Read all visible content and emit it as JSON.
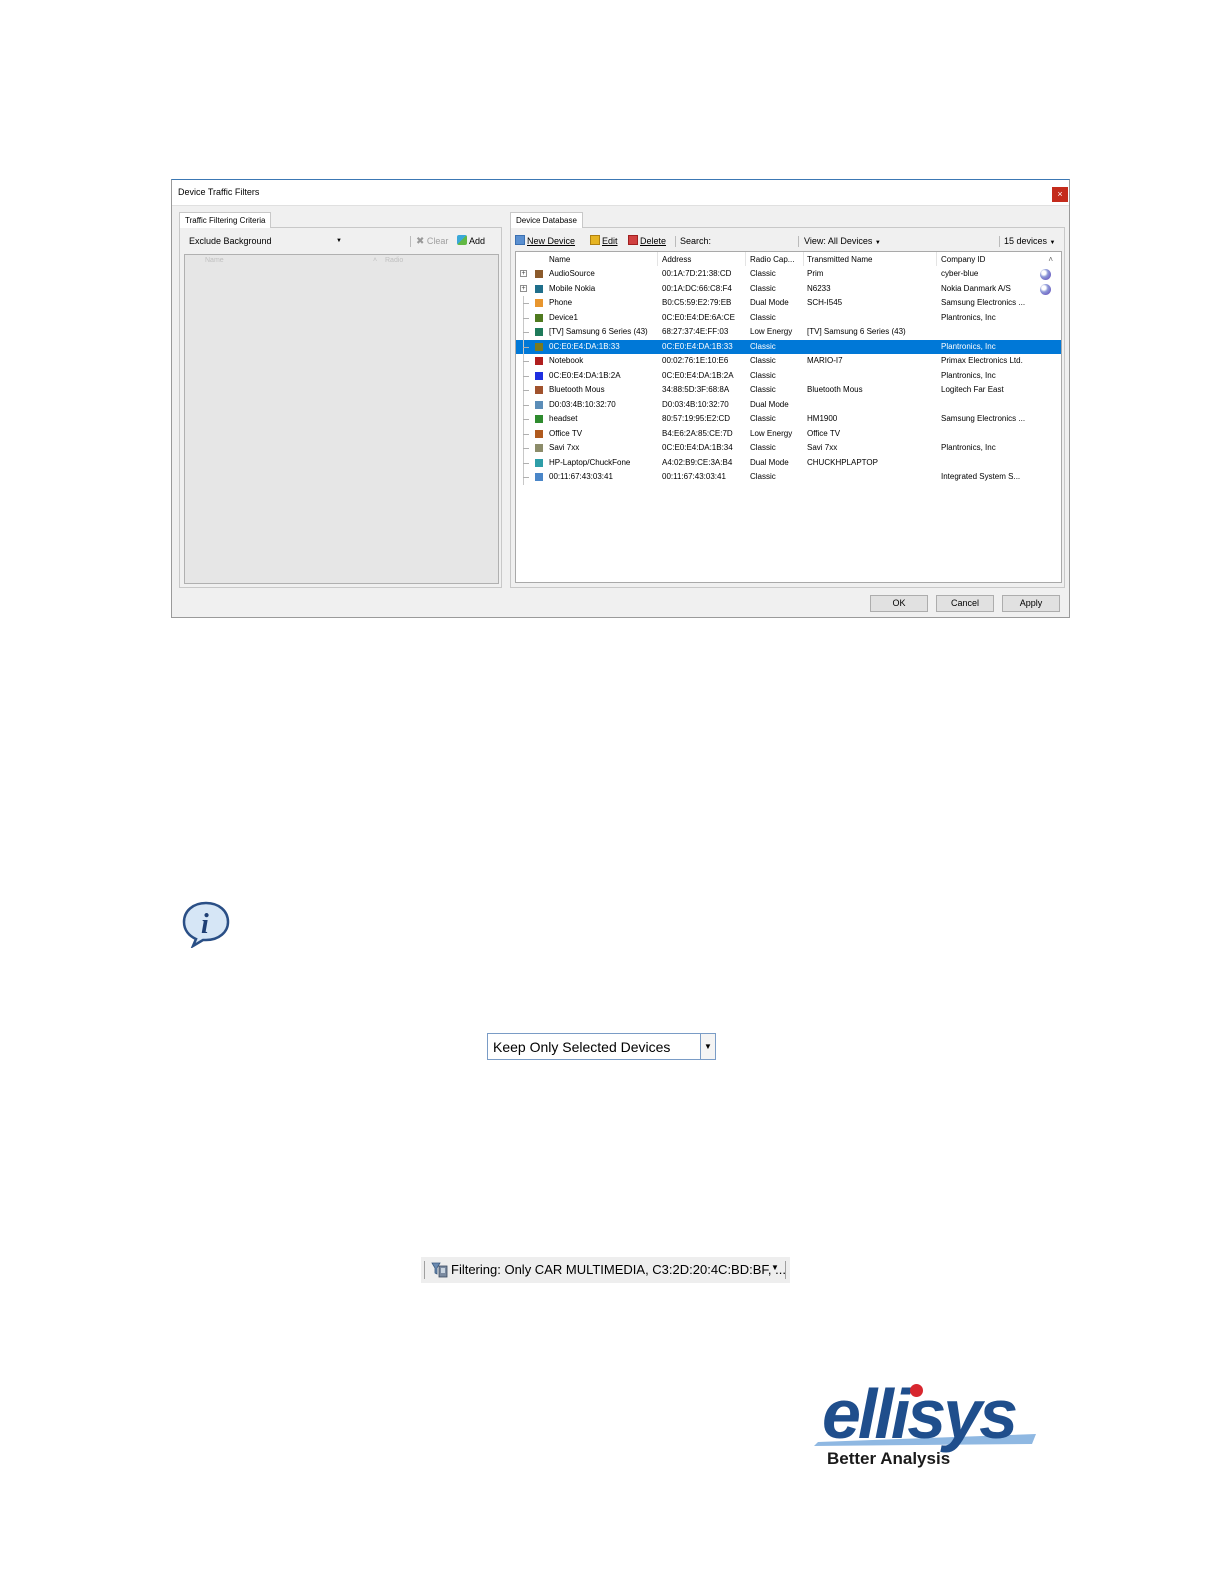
{
  "dialog": {
    "title": "Device Traffic Filters",
    "close_label": "×",
    "left_tab": "Traffic Filtering Criteria",
    "criteria_mode": "Exclude Background",
    "clear_label": "Clear",
    "add_label": "Add",
    "criteria_columns": [
      "Name",
      "Radio"
    ],
    "right_tab": "Device Database",
    "new_device_label": "New Device",
    "edit_label": "Edit",
    "delete_label": "Delete",
    "search_label": "Search:",
    "view_label": "View: All Devices",
    "device_count": "15 devices",
    "columns": [
      "Name",
      "Address",
      "Radio Cap...",
      "Transmitted Name",
      "Company ID"
    ],
    "devices": [
      {
        "name": "AudioSource",
        "address": "00:1A:7D:21:38:CD",
        "radio": "Classic",
        "tx": "Prim",
        "company": "cyber-blue",
        "color": "#8B5A2B",
        "expander": true,
        "status": true
      },
      {
        "name": "Mobile Nokia",
        "address": "00:1A:DC:66:C8:F4",
        "radio": "Classic",
        "tx": "N6233",
        "company": "Nokia Danmark A/S",
        "color": "#1F6F8B",
        "expander": true,
        "status": true
      },
      {
        "name": "Phone",
        "address": "B0:C5:59:E2:79:EB",
        "radio": "Dual Mode",
        "tx": "SCH-I545",
        "company": "Samsung Electronics ...",
        "color": "#E8962E"
      },
      {
        "name": "Device1",
        "address": "0C:E0:E4:DE:6A:CE",
        "radio": "Classic",
        "tx": "",
        "company": "Plantronics, Inc",
        "color": "#4F7A1F"
      },
      {
        "name": "[TV] Samsung 6 Series (43)",
        "address": "68:27:37:4E:FF:03",
        "radio": "Low Energy",
        "tx": "[TV] Samsung 6 Series (43)",
        "company": "",
        "color": "#1F7A5A"
      },
      {
        "name": "0C:E0:E4:DA:1B:33",
        "address": "0C:E0:E4:DA:1B:33",
        "radio": "Classic",
        "tx": "",
        "company": "Plantronics, Inc",
        "color": "#7A7A1F",
        "selected": true
      },
      {
        "name": "Notebook",
        "address": "00:02:76:1E:10:E6",
        "radio": "Classic",
        "tx": "MARIO-I7",
        "company": "Primax Electronics Ltd.",
        "color": "#B01E1E"
      },
      {
        "name": "0C:E0:E4:DA:1B:2A",
        "address": "0C:E0:E4:DA:1B:2A",
        "radio": "Classic",
        "tx": "",
        "company": "Plantronics, Inc",
        "color": "#1E2EE0"
      },
      {
        "name": "Bluetooth Mous",
        "address": "34:88:5D:3F:68:8A",
        "radio": "Classic",
        "tx": "Bluetooth Mous",
        "company": "Logitech Far East",
        "color": "#A0522D"
      },
      {
        "name": "D0:03:4B:10:32:70",
        "address": "D0:03:4B:10:32:70",
        "radio": "Dual Mode",
        "tx": "",
        "company": "",
        "color": "#5B8DB8"
      },
      {
        "name": "headset",
        "address": "80:57:19:95:E2:CD",
        "radio": "Classic",
        "tx": "HM1900",
        "company": "Samsung Electronics ...",
        "color": "#2E8B2E"
      },
      {
        "name": "Office TV",
        "address": "B4:E6:2A:85:CE:7D",
        "radio": "Low Energy",
        "tx": "Office TV",
        "company": "",
        "color": "#B05A1E"
      },
      {
        "name": "Savi 7xx",
        "address": "0C:E0:E4:DA:1B:34",
        "radio": "Classic",
        "tx": "Savi 7xx",
        "company": "Plantronics, Inc",
        "color": "#8C8C6A"
      },
      {
        "name": "HP-Laptop/ChuckFone",
        "address": "A4:02:B9:CE:3A:B4",
        "radio": "Dual Mode",
        "tx": "CHUCKHPLAPTOP",
        "company": "",
        "color": "#2E9EA8"
      },
      {
        "name": "00:11:67:43:03:41",
        "address": "00:11:67:43:03:41",
        "radio": "Classic",
        "tx": "",
        "company": "Integrated System S...",
        "color": "#4A86C8"
      }
    ],
    "ok_label": "OK",
    "cancel_label": "Cancel",
    "apply_label": "Apply"
  },
  "keep_combo": {
    "value": "Keep Only Selected Devices"
  },
  "filter_status": {
    "text": "Filtering: Only CAR MULTIMEDIA, C3:2D:20:4C:BD:BF, ..."
  },
  "logo": {
    "word": "ellisys",
    "tagline": "Better Analysis"
  },
  "colors": {
    "selection": "#0078d7",
    "close": "#c42b1c",
    "brand_blue": "#1f4e8c",
    "brand_red": "#d8262e"
  }
}
